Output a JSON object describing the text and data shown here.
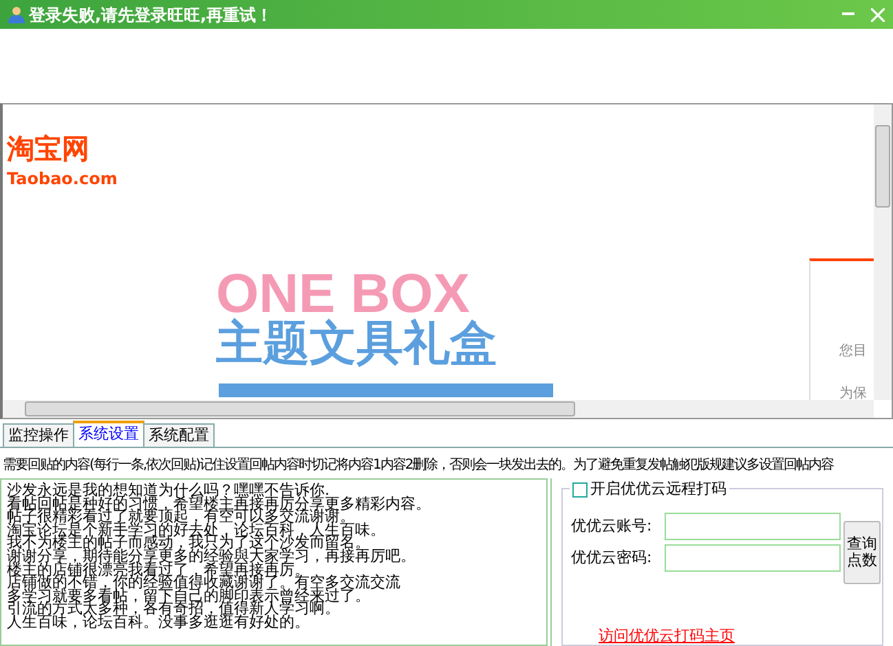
{
  "window": {
    "title": "登录失败,请先登录旺旺,再重试！"
  },
  "browser": {
    "logo": "淘宝网",
    "logo_sub": "Taobao.com",
    "ad_line_1": "ONE BOX",
    "ad_line_2": "主题文具礼盒",
    "side_line_1": "您目",
    "side_line_2": "为保"
  },
  "tabs": [
    {
      "label": "监控操作",
      "selected": false
    },
    {
      "label": "系统设置",
      "selected": true
    },
    {
      "label": "系统配置",
      "selected": false
    }
  ],
  "instruction": "需要回贴的内容(每行一条,依次回贴)记住设置回帖内容时切记将内容1内容2删除，否则会一块发出去的。为了避免重复发帖触犯版规建议多设置回帖内容",
  "reply_lines": [
    "沙发永远是我的想知道为什么吗？嘿嘿不告诉你.",
    "看帖回帖是种好的习惯，希望楼主再接再厉分享更多精彩内容。",
    "帖子很精彩看过了就要顶起，有空可以多交流谢谢。",
    "淘宝论坛是个新手学习的好去处，论坛百科，人生百味。",
    "我不为楼主的帖子而感动，我只为了这个沙发而留名。",
    "谢谢分享，期待能分享更多的经验與大家学习，再接再厉吧。",
    "楼主的店铺很漂亮我看过了，希望再接再厉。",
    "店铺做的不错，你的经验值得收藏谢谢了。有空多交流交流",
    "多学习就要多看帖，留下自己的脚印表示曾经来过了。",
    "引流的方式太多种，各有奇招，值得新人学习啊。",
    "人生百味，论坛百科。没事多逛逛有好处的。"
  ],
  "captcha": {
    "enable_label": "开启优优云远程打码",
    "checked": false,
    "account_label": "优优云账号:",
    "password_label": "优优云密码:",
    "query_button": "查询点数",
    "link": "访问优优云打码主页"
  }
}
